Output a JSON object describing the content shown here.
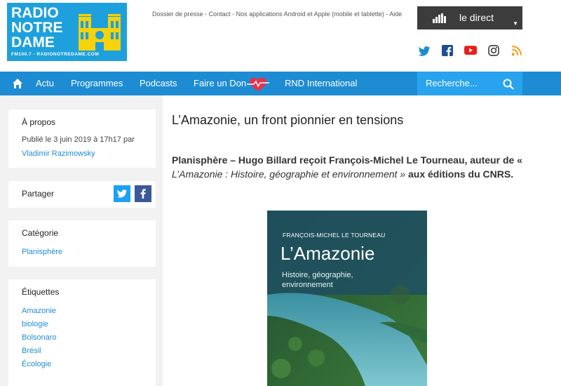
{
  "logo": {
    "line1": "RADIO",
    "line2": "NOTRE",
    "line3": "DAME",
    "sub": "FM100.7 - RADIONOTREDAME.COM"
  },
  "toplinks": {
    "presse": "Dossier de presse",
    "contact": "Contact",
    "apps": "Nos applications Android et Apple (mobile et tablette)",
    "aide": "Aide",
    "sep": " - "
  },
  "live": {
    "label": "le direct"
  },
  "social": [
    "twitter-icon",
    "facebook-icon",
    "youtube-icon",
    "instagram-icon",
    "rss-icon"
  ],
  "nav": {
    "items": [
      "Actu",
      "Programmes",
      "Podcasts",
      "Faire un Don",
      "RND International"
    ],
    "search_placeholder": "Recherche..."
  },
  "sidebar": {
    "apropos": {
      "title": "À propos",
      "published": "Publié le 3 juin 2019 à 17h17 par",
      "author": "Vladimir Razimowsky"
    },
    "share": {
      "title": "Partager"
    },
    "category": {
      "title": "Catégorie",
      "value": "Planisphère"
    },
    "tags": {
      "title": "Étiquettes",
      "items": [
        "Amazonie",
        "biologie",
        "Bolsonaro",
        "Brésil",
        "Écologie"
      ]
    }
  },
  "article": {
    "title": "L’Amazonie, un front pionnier en tensions",
    "lead_bold": "Planisphère – Hugo Billard reçoit François-Michel Le Tourneau, auteur de «",
    "lead_italic": "L’Amazonie : Histoire, géographie et environnement »",
    "lead_end": " aux éditions du CNRS.",
    "book": {
      "author": "FRANÇOIS-MICHEL LE TOURNEAU",
      "title": "L’Amazonie",
      "subtitle": "Histoire, géographie, environnement"
    }
  },
  "colors": {
    "brand_blue": "#1e8cd3",
    "logo_blue": "#1ea0dc",
    "search_blue": "#2aa3ef",
    "dark": "#3c3c3c",
    "background": "#f2f2f2"
  }
}
